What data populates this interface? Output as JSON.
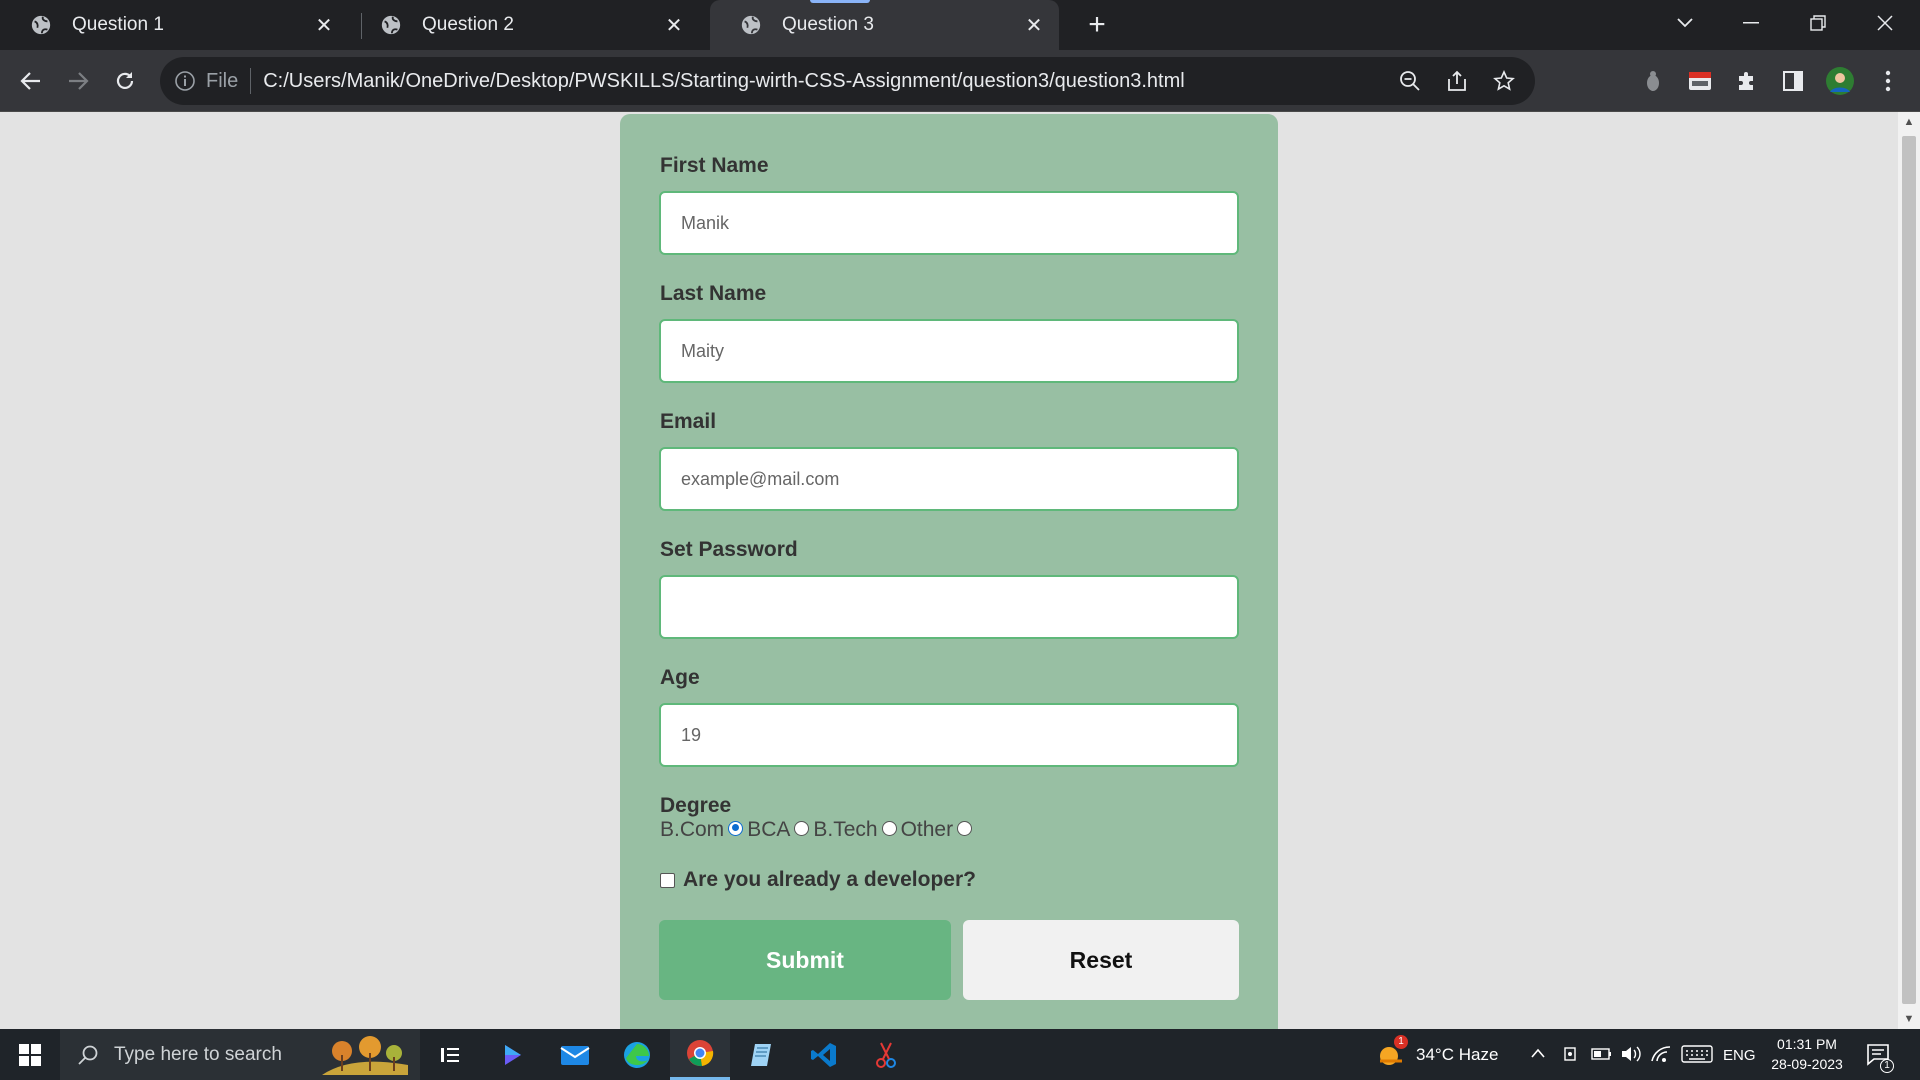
{
  "browser": {
    "tabs": [
      {
        "title": "Question 1"
      },
      {
        "title": "Question 2"
      },
      {
        "title": "Question 3"
      }
    ],
    "omnibox": {
      "scheme_label": "File",
      "url": "C:/Users/Manik/OneDrive/Desktop/PWSKILLS/Starting-wirth-CSS-Assignment/question3/question3.html"
    }
  },
  "form": {
    "first_name": {
      "label": "First Name",
      "value": "Manik"
    },
    "last_name": {
      "label": "Last Name",
      "value": "Maity"
    },
    "email": {
      "label": "Email",
      "placeholder": "example@mail.com"
    },
    "password": {
      "label": "Set Password",
      "value": ""
    },
    "age": {
      "label": "Age",
      "value": "19"
    },
    "degree": {
      "label": "Degree",
      "options": [
        {
          "label": "B.Com",
          "checked": true
        },
        {
          "label": "BCA",
          "checked": false
        },
        {
          "label": "B.Tech",
          "checked": false
        },
        {
          "label": "Other",
          "checked": false
        }
      ]
    },
    "developer_check": {
      "label": "Are you already a developer?",
      "checked": false
    },
    "submit_label": "Submit",
    "reset_label": "Reset"
  },
  "taskbar": {
    "search_placeholder": "Type here to search",
    "weather": "34°C  Haze",
    "weather_badge": "1",
    "language": "ENG",
    "time": "01:31 PM",
    "date": "28-09-2023",
    "notification_count": "1"
  },
  "colors": {
    "form_bg": "#98bfa3",
    "input_border": "#5fb87a",
    "submit_bg": "#68b582",
    "reset_bg": "#f1f1f1",
    "page_bg": "#e3e3e3"
  }
}
